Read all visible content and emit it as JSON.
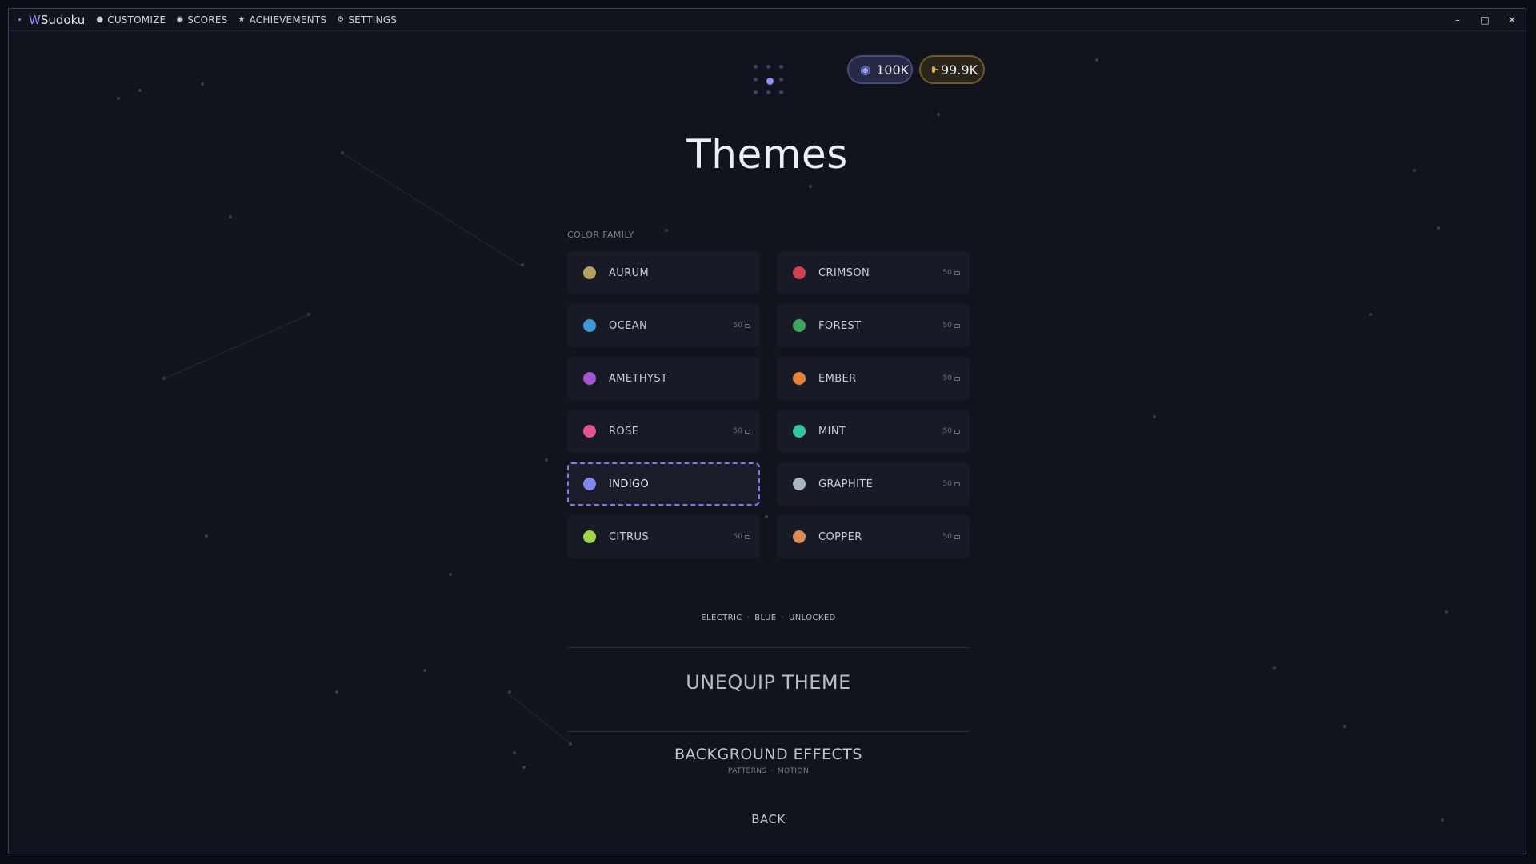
{
  "titlebar": {
    "app_prefix": "W",
    "app_name": "Sudoku",
    "menu": [
      {
        "label": "CUSTOMIZE",
        "icon": "palette-icon"
      },
      {
        "label": "SCORES",
        "icon": "medal-icon"
      },
      {
        "label": "ACHIEVEMENTS",
        "icon": "star-icon"
      },
      {
        "label": "SETTINGS",
        "icon": "gear-icon"
      }
    ]
  },
  "currency": {
    "medals": "100K",
    "coins": "99.9K"
  },
  "page": {
    "title": "Themes",
    "section_label": "COLOR FAMILY"
  },
  "themes": [
    {
      "label": "AURUM",
      "color": "#b5a05d",
      "price": ""
    },
    {
      "label": "CRIMSON",
      "color": "#d2414f",
      "price": "50"
    },
    {
      "label": "OCEAN",
      "color": "#3c99d6",
      "price": "50"
    },
    {
      "label": "FOREST",
      "color": "#3fa55e",
      "price": "50"
    },
    {
      "label": "AMETHYST",
      "color": "#a655d1",
      "price": ""
    },
    {
      "label": "EMBER",
      "color": "#e8823a",
      "price": "50"
    },
    {
      "label": "ROSE",
      "color": "#e2558f",
      "price": "50"
    },
    {
      "label": "MINT",
      "color": "#2fc79d",
      "price": "50"
    },
    {
      "label": "INDIGO",
      "color": "#8187f0",
      "price": "",
      "selected": true
    },
    {
      "label": "GRAPHITE",
      "color": "#a8b6c2",
      "price": "50"
    },
    {
      "label": "CITRUS",
      "color": "#9fd64a",
      "price": "50"
    },
    {
      "label": "COPPER",
      "color": "#de8a52",
      "price": "50"
    }
  ],
  "info": {
    "parts": [
      "ELECTRIC",
      "BLUE",
      "UNLOCKED"
    ]
  },
  "actions": {
    "unequip": "UNEQUIP THEME",
    "background_effects": "BACKGROUND EFFECTS",
    "background_sub": [
      "PATTERNS",
      "MOTION"
    ],
    "back": "BACK"
  }
}
